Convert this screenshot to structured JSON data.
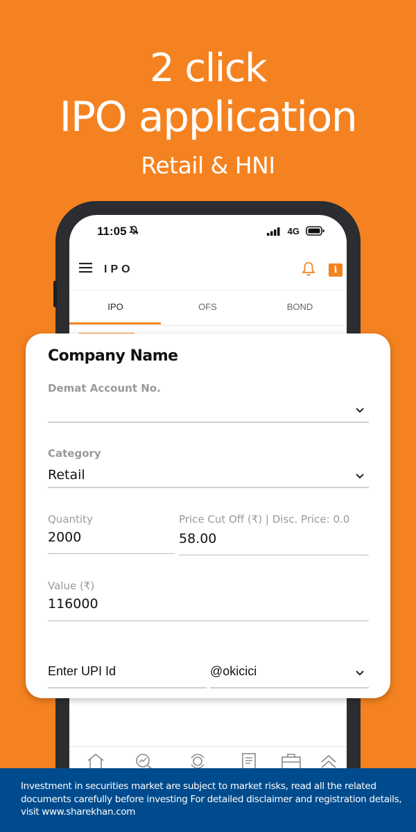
{
  "promo": {
    "headline_1": "2 click",
    "headline_2": "IPO application",
    "subheadline": "Retail & HNI"
  },
  "status_bar": {
    "time": "11:05",
    "network": "4G"
  },
  "app_bar": {
    "title": "IPO"
  },
  "tabs": [
    {
      "label": "IPO",
      "active": true
    },
    {
      "label": "OFS",
      "active": false
    },
    {
      "label": "BOND",
      "active": false
    }
  ],
  "form": {
    "title": "Company Name",
    "demat": {
      "label": "Demat Account No.",
      "value": ""
    },
    "category": {
      "label": "Category",
      "value": "Retail"
    },
    "quantity": {
      "label": "Quantity",
      "value": "2000"
    },
    "price": {
      "label": "Price Cut Off (₹) | Disc. Price: 0.0",
      "value": "58.00"
    },
    "value": {
      "label": "Value (₹)",
      "value": "116000"
    },
    "upi": {
      "placeholder": "Enter UPI Id",
      "handle": "@okicici"
    }
  },
  "disclaimer": "Investment in securities market are subject to market risks, read all the related documents carefully before investing For detailed disclaimer and registration details, visit www.sharekhan.com",
  "colors": {
    "brand_orange": "#F58220",
    "disclaimer_blue": "#004B8D"
  },
  "icons": {
    "bottom_nav": [
      "home-icon",
      "market-search-icon",
      "explore-icon",
      "news-icon",
      "portfolio-icon",
      "more-up-icon"
    ]
  }
}
